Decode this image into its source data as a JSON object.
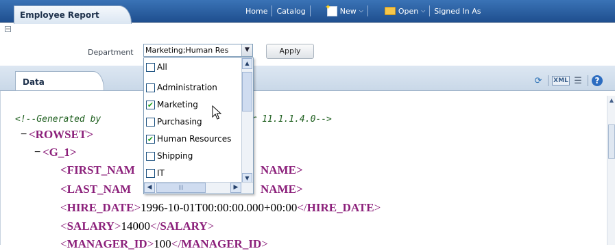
{
  "header": {
    "report_title": "Employee Report",
    "nav": {
      "home": "Home",
      "catalog": "Catalog",
      "new": "New",
      "open": "Open",
      "signed_in": "Signed In As"
    }
  },
  "parameters": {
    "department_label": "Department",
    "department_value": "Marketing;Human Res",
    "apply_label": "Apply"
  },
  "dropdown": {
    "options": [
      {
        "label": "All",
        "checked": false
      },
      {
        "label": "Administration",
        "checked": false
      },
      {
        "label": "Marketing",
        "checked": true
      },
      {
        "label": "Purchasing",
        "checked": false
      },
      {
        "label": "Human Resources",
        "checked": true
      },
      {
        "label": "Shipping",
        "checked": false
      },
      {
        "label": "IT",
        "checked": false
      }
    ]
  },
  "data_tab": {
    "label": "Data",
    "toolbar_icons": [
      "refresh-icon",
      "xml-export-icon",
      "list-icon",
      "help-icon"
    ]
  },
  "xml": {
    "comment_left": "<!--Generated by",
    "comment_right": "sher 11.1.1.4.0-->",
    "rowset_open": "<ROWSET>",
    "g1_open": "<G_1>",
    "first_name_left": "<FIRST_NAM",
    "first_name_right": "NAME>",
    "last_name_left": "<LAST_NAM",
    "last_name_right": "NAME>",
    "hire_date_open": "HIRE_DATE",
    "hire_date_value": "1996-10-01T00:00:00.000+00:00",
    "hire_date_close": "HIRE_DATE",
    "salary_open": "SALARY",
    "salary_value": "14000",
    "salary_close": "SALARY",
    "manager_open": "MANAGER_ID",
    "manager_value": "100",
    "manager_close": "MANAGER_ID"
  }
}
